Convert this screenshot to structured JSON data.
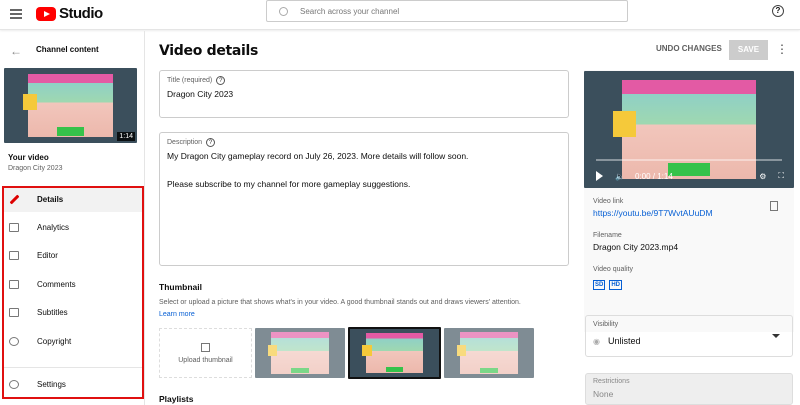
{
  "header": {
    "logo_text": "Studio",
    "search_placeholder": "Search across your channel",
    "help_label": "?"
  },
  "sidebar": {
    "back_label": "Channel content",
    "thumbnail_duration": "1:14",
    "your_video_label": "Your video",
    "video_name": "Dragon City 2023",
    "items": [
      {
        "label": "Details",
        "icon": "pencil-icon",
        "active": true
      },
      {
        "label": "Analytics",
        "icon": "analytics-icon"
      },
      {
        "label": "Editor",
        "icon": "editor-icon"
      },
      {
        "label": "Comments",
        "icon": "comments-icon"
      },
      {
        "label": "Subtitles",
        "icon": "subtitles-icon"
      },
      {
        "label": "Copyright",
        "icon": "copyright-icon"
      },
      {
        "label": "Settings",
        "icon": "gear-icon"
      }
    ]
  },
  "main": {
    "page_title": "Video details",
    "undo_label": "UNDO CHANGES",
    "save_label": "SAVE",
    "title_field": {
      "label": "Title (required)",
      "value": "Dragon City 2023"
    },
    "description_field": {
      "label": "Description",
      "line1": "My Dragon City gameplay record on July 26, 2023. More details will follow soon.",
      "line2": "Please subscribe to my channel for more gameplay suggestions."
    },
    "thumbnail": {
      "heading": "Thumbnail",
      "help": "Select or upload a picture that shows what's in your video. A good thumbnail stands out and draws viewers' attention.",
      "learn_more": "Learn more",
      "upload_label": "Upload thumbnail"
    },
    "playlists_heading": "Playlists"
  },
  "right": {
    "player_time": "0:00 / 1:14",
    "video_link_label": "Video link",
    "video_link": "https://youtu.be/9T7WvtAUuDM",
    "filename_label": "Filename",
    "filename": "Dragon City 2023.mp4",
    "quality_label": "Video quality",
    "quality_badges": [
      "SD",
      "HD"
    ],
    "visibility_label": "Visibility",
    "visibility_value": "Unlisted",
    "restrictions_label": "Restrictions",
    "restrictions_value": "None"
  },
  "colors": {
    "accent": "#065fd4",
    "brand": "#ff0000",
    "highlight_box": "#e01010"
  }
}
